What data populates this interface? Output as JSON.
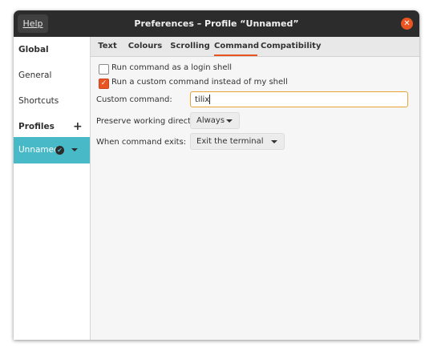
{
  "titlebar": {
    "help_label": "Help",
    "title": "Preferences – Profile “Unnamed”",
    "close_symbol": "✕"
  },
  "sidebar": {
    "global_label": "Global",
    "general_label": "General",
    "shortcuts_label": "Shortcuts",
    "profiles_label": "Profiles",
    "add_symbol": "+",
    "selected_profile": "Unnamed",
    "check_symbol": "✔"
  },
  "tabs": [
    "Text",
    "Colours",
    "Scrolling",
    "Command",
    "Compatibility"
  ],
  "active_tab": "Command",
  "command": {
    "login_shell_label": "Run command as a login shell",
    "login_shell_checked": false,
    "custom_command_label": "Run a custom command instead of my shell",
    "custom_command_checked": true,
    "check_symbol": "✓",
    "custom_command_field_label": "Custom command:",
    "custom_command_value": "tilix",
    "preserve_dir_label": "Preserve working directory:",
    "preserve_dir_value": "Always",
    "exit_label": "When command exits:",
    "exit_value": "Exit the terminal"
  },
  "colors": {
    "accent": "#e95420",
    "selection": "#48b9c7",
    "titlebar": "#2c2c2c",
    "focus_border": "#e6a33a"
  }
}
